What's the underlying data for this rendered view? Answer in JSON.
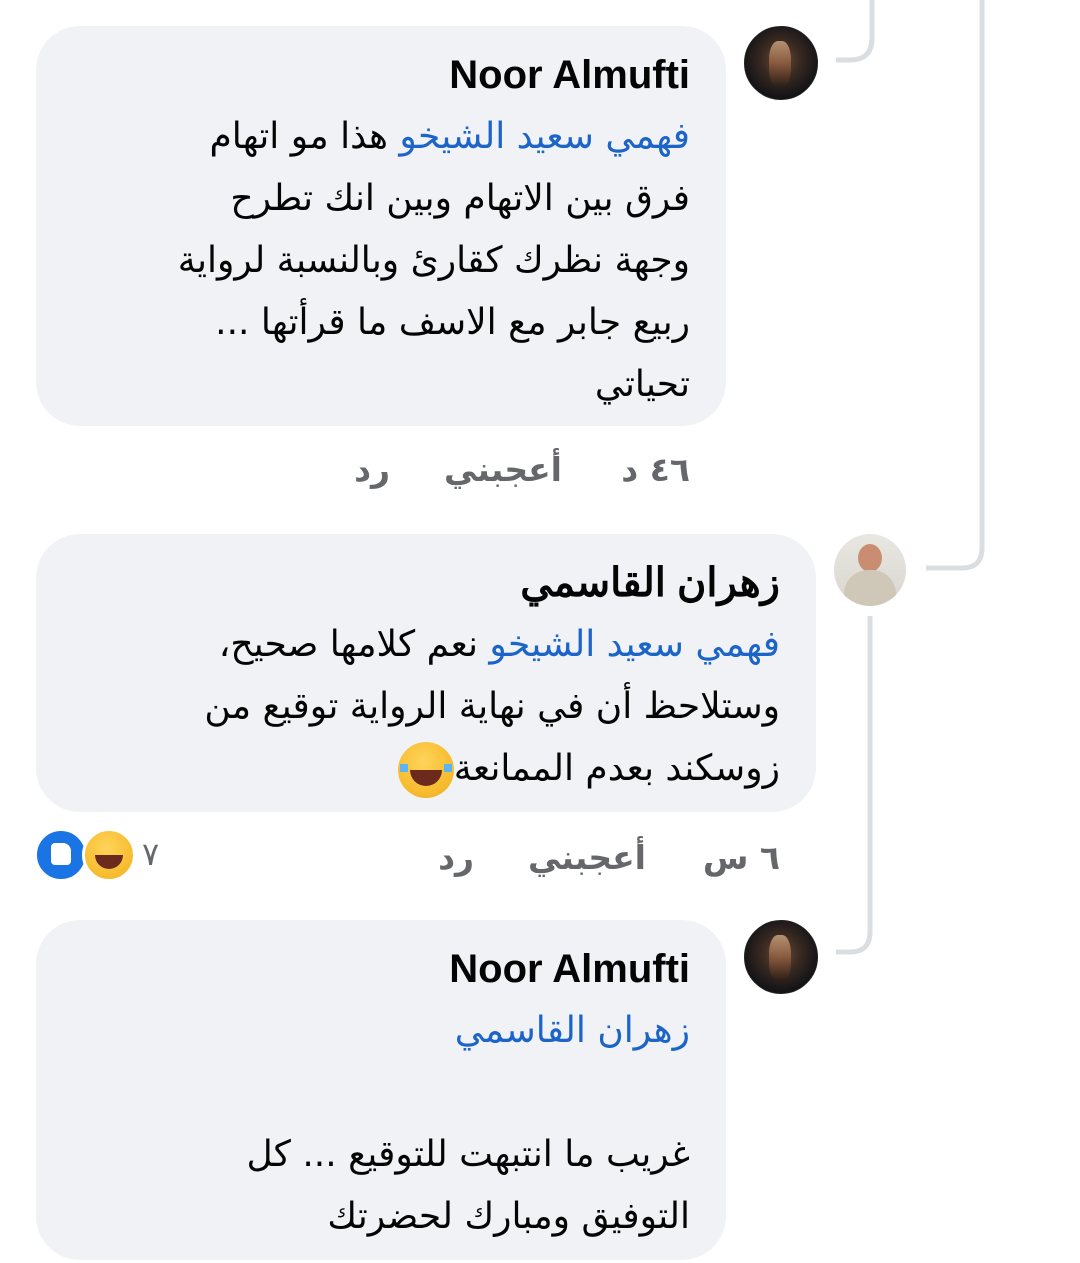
{
  "comments": [
    {
      "author": "Noor Almufti",
      "mention": "فهمي سعيد الشيخو",
      "lines": [
        "  هذا مو اتهام",
        "فرق بين الاتهام وبين انك تطرح",
        "وجهة نظرك كقارئ وبالنسبة لرواية",
        "ربيع جابر مع الاسف ما قرأتها ...",
        "تحياتي"
      ],
      "time": "٤٦ د",
      "like": "أعجبني",
      "reply": "رد"
    },
    {
      "author": "زهران القاسمي",
      "mention": "فهمي سعيد الشيخو",
      "lines": [
        " نعم كلامها صحيح،",
        "وستلاحظ أن في نهاية الرواية توقيع من",
        "زوسكند بعدم الممانعة"
      ],
      "emoji": "joy-emoji",
      "time": "٦ س",
      "like": "أعجبني",
      "reply": "رد",
      "reaction_count": "٧",
      "reactions": [
        "like-reaction-icon",
        "haha-reaction-icon"
      ]
    },
    {
      "author": "Noor Almufti",
      "mention": "زهران القاسمي",
      "lines": [
        "غريب ما انتبهت للتوقيع ... كل",
        "التوفيق ومبارك لحضرتك"
      ]
    }
  ],
  "colors": {
    "bubble": "#f0f2f5",
    "mention": "#1c64c8",
    "meta": "#65676b",
    "thread_line": "#dadde1"
  }
}
